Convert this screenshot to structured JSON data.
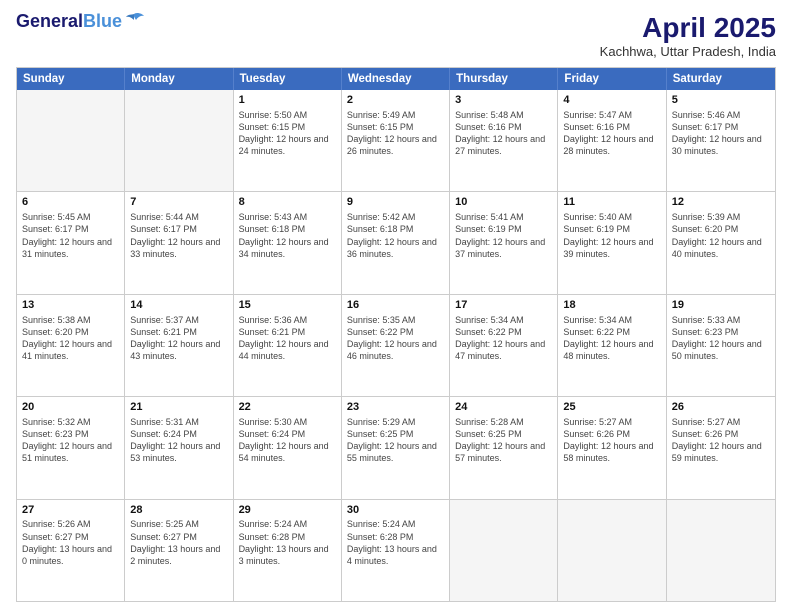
{
  "logo": {
    "line1": "General",
    "line2": "Blue"
  },
  "title": "April 2025",
  "subtitle": "Kachhwa, Uttar Pradesh, India",
  "days": [
    "Sunday",
    "Monday",
    "Tuesday",
    "Wednesday",
    "Thursday",
    "Friday",
    "Saturday"
  ],
  "weeks": [
    [
      {
        "day": "",
        "detail": ""
      },
      {
        "day": "",
        "detail": ""
      },
      {
        "day": "1",
        "detail": "Sunrise: 5:50 AM\nSunset: 6:15 PM\nDaylight: 12 hours and 24 minutes."
      },
      {
        "day": "2",
        "detail": "Sunrise: 5:49 AM\nSunset: 6:15 PM\nDaylight: 12 hours and 26 minutes."
      },
      {
        "day": "3",
        "detail": "Sunrise: 5:48 AM\nSunset: 6:16 PM\nDaylight: 12 hours and 27 minutes."
      },
      {
        "day": "4",
        "detail": "Sunrise: 5:47 AM\nSunset: 6:16 PM\nDaylight: 12 hours and 28 minutes."
      },
      {
        "day": "5",
        "detail": "Sunrise: 5:46 AM\nSunset: 6:17 PM\nDaylight: 12 hours and 30 minutes."
      }
    ],
    [
      {
        "day": "6",
        "detail": "Sunrise: 5:45 AM\nSunset: 6:17 PM\nDaylight: 12 hours and 31 minutes."
      },
      {
        "day": "7",
        "detail": "Sunrise: 5:44 AM\nSunset: 6:17 PM\nDaylight: 12 hours and 33 minutes."
      },
      {
        "day": "8",
        "detail": "Sunrise: 5:43 AM\nSunset: 6:18 PM\nDaylight: 12 hours and 34 minutes."
      },
      {
        "day": "9",
        "detail": "Sunrise: 5:42 AM\nSunset: 6:18 PM\nDaylight: 12 hours and 36 minutes."
      },
      {
        "day": "10",
        "detail": "Sunrise: 5:41 AM\nSunset: 6:19 PM\nDaylight: 12 hours and 37 minutes."
      },
      {
        "day": "11",
        "detail": "Sunrise: 5:40 AM\nSunset: 6:19 PM\nDaylight: 12 hours and 39 minutes."
      },
      {
        "day": "12",
        "detail": "Sunrise: 5:39 AM\nSunset: 6:20 PM\nDaylight: 12 hours and 40 minutes."
      }
    ],
    [
      {
        "day": "13",
        "detail": "Sunrise: 5:38 AM\nSunset: 6:20 PM\nDaylight: 12 hours and 41 minutes."
      },
      {
        "day": "14",
        "detail": "Sunrise: 5:37 AM\nSunset: 6:21 PM\nDaylight: 12 hours and 43 minutes."
      },
      {
        "day": "15",
        "detail": "Sunrise: 5:36 AM\nSunset: 6:21 PM\nDaylight: 12 hours and 44 minutes."
      },
      {
        "day": "16",
        "detail": "Sunrise: 5:35 AM\nSunset: 6:22 PM\nDaylight: 12 hours and 46 minutes."
      },
      {
        "day": "17",
        "detail": "Sunrise: 5:34 AM\nSunset: 6:22 PM\nDaylight: 12 hours and 47 minutes."
      },
      {
        "day": "18",
        "detail": "Sunrise: 5:34 AM\nSunset: 6:22 PM\nDaylight: 12 hours and 48 minutes."
      },
      {
        "day": "19",
        "detail": "Sunrise: 5:33 AM\nSunset: 6:23 PM\nDaylight: 12 hours and 50 minutes."
      }
    ],
    [
      {
        "day": "20",
        "detail": "Sunrise: 5:32 AM\nSunset: 6:23 PM\nDaylight: 12 hours and 51 minutes."
      },
      {
        "day": "21",
        "detail": "Sunrise: 5:31 AM\nSunset: 6:24 PM\nDaylight: 12 hours and 53 minutes."
      },
      {
        "day": "22",
        "detail": "Sunrise: 5:30 AM\nSunset: 6:24 PM\nDaylight: 12 hours and 54 minutes."
      },
      {
        "day": "23",
        "detail": "Sunrise: 5:29 AM\nSunset: 6:25 PM\nDaylight: 12 hours and 55 minutes."
      },
      {
        "day": "24",
        "detail": "Sunrise: 5:28 AM\nSunset: 6:25 PM\nDaylight: 12 hours and 57 minutes."
      },
      {
        "day": "25",
        "detail": "Sunrise: 5:27 AM\nSunset: 6:26 PM\nDaylight: 12 hours and 58 minutes."
      },
      {
        "day": "26",
        "detail": "Sunrise: 5:27 AM\nSunset: 6:26 PM\nDaylight: 12 hours and 59 minutes."
      }
    ],
    [
      {
        "day": "27",
        "detail": "Sunrise: 5:26 AM\nSunset: 6:27 PM\nDaylight: 13 hours and 0 minutes."
      },
      {
        "day": "28",
        "detail": "Sunrise: 5:25 AM\nSunset: 6:27 PM\nDaylight: 13 hours and 2 minutes."
      },
      {
        "day": "29",
        "detail": "Sunrise: 5:24 AM\nSunset: 6:28 PM\nDaylight: 13 hours and 3 minutes."
      },
      {
        "day": "30",
        "detail": "Sunrise: 5:24 AM\nSunset: 6:28 PM\nDaylight: 13 hours and 4 minutes."
      },
      {
        "day": "",
        "detail": ""
      },
      {
        "day": "",
        "detail": ""
      },
      {
        "day": "",
        "detail": ""
      }
    ]
  ]
}
